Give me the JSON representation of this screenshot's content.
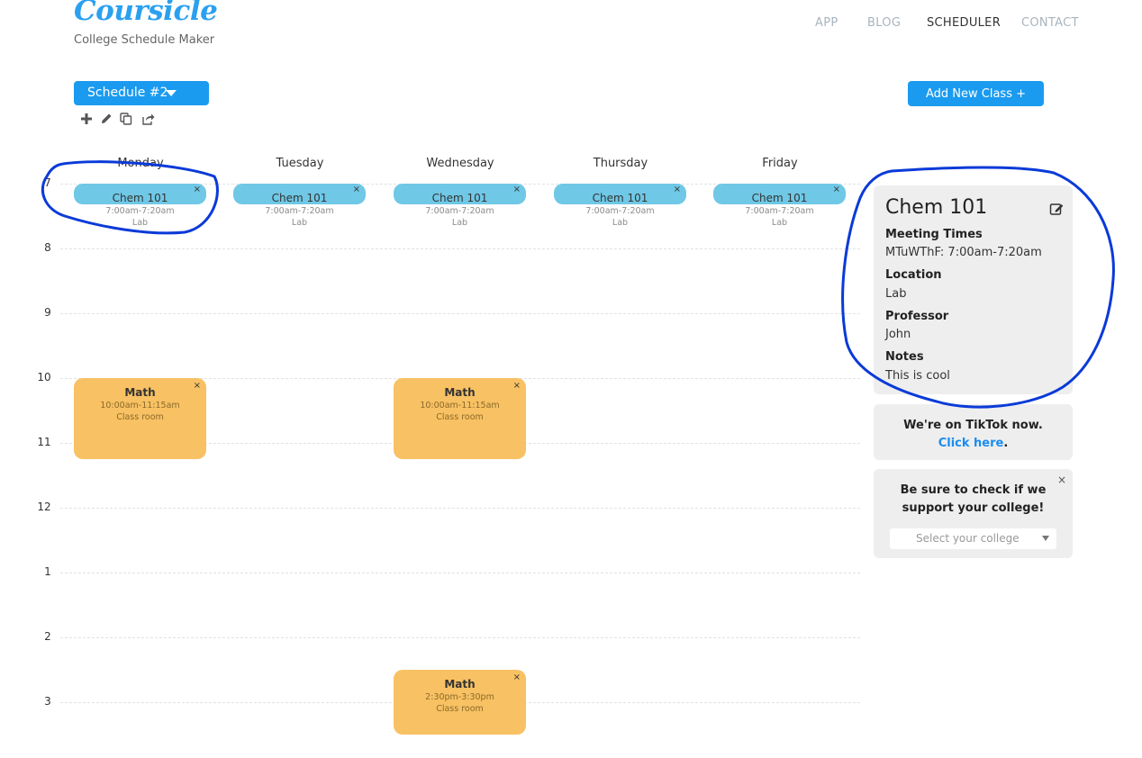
{
  "brand": {
    "logo": "Coursicle",
    "tagline": "College Schedule Maker"
  },
  "nav": {
    "app": "APP",
    "blog": "BLOG",
    "scheduler": "SCHEDULER",
    "contact": "CONTACT"
  },
  "toolbar": {
    "schedule_label": "Schedule #2",
    "add_class_label": "Add New Class +",
    "icons": [
      "plus-icon",
      "pencil-icon",
      "copy-icon",
      "share-icon"
    ]
  },
  "calendar": {
    "days": [
      "Monday",
      "Tuesday",
      "Wednesday",
      "Thursday",
      "Friday"
    ],
    "hours": [
      "7",
      "8",
      "9",
      "10",
      "11",
      "12",
      "1",
      "2",
      "3"
    ],
    "chem": {
      "title": "Chem 101",
      "time": "7:00am-7:20am",
      "location": "Lab"
    },
    "math_morning": {
      "title": "Math",
      "time": "10:00am-11:15am",
      "location": "Class room"
    },
    "math_afternoon": {
      "title": "Math",
      "time": "2:30pm-3:30pm",
      "location": "Class room"
    },
    "close_symbol": "×"
  },
  "details": {
    "title": "Chem 101",
    "meeting_label": "Meeting Times",
    "meeting_value": "MTuWThF: 7:00am-7:20am",
    "location_label": "Location",
    "location_value": "Lab",
    "professor_label": "Professor",
    "professor_value": "John",
    "notes_label": "Notes",
    "notes_value": "This is cool"
  },
  "tiktok": {
    "line1": "We're on TikTok now.",
    "link": "Click here",
    "period": "."
  },
  "college": {
    "line1": "Be sure to check if we",
    "line2": "support your college!",
    "select_placeholder": "Select your college",
    "close_symbol": "×"
  },
  "colors": {
    "accent": "#1a9bf0",
    "event_blue": "#6fc8e6",
    "event_orange": "#f8c163",
    "annotation": "#0a3ad8"
  }
}
